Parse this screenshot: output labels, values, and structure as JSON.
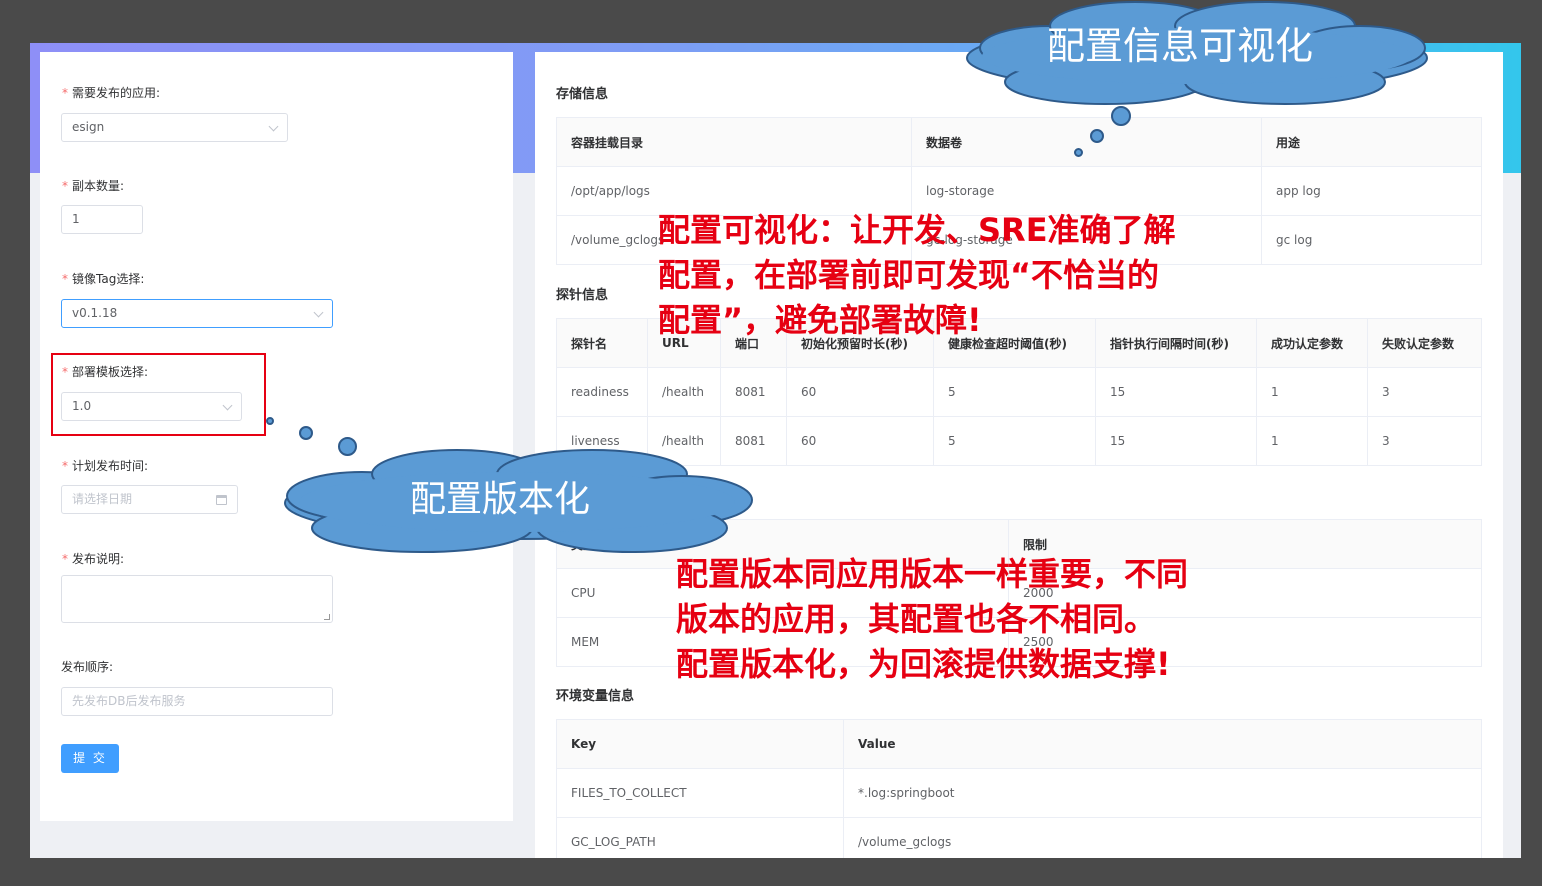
{
  "form": {
    "app": {
      "label": "需要发布的应用:",
      "value": "esign"
    },
    "replicas": {
      "label": "副本数量:",
      "value": "1"
    },
    "image_tag": {
      "label": "镜像Tag选择:",
      "value": "v0.1.18"
    },
    "template": {
      "label": "部署模板选择:",
      "value": "1.0"
    },
    "schedule": {
      "label": "计划发布时间:",
      "placeholder": "请选择日期"
    },
    "notes": {
      "label": "发布说明:"
    },
    "order": {
      "label": "发布顺序:",
      "placeholder": "先发布DB后发布服务"
    },
    "submit_label": "提 交"
  },
  "storage": {
    "title": "存储信息",
    "columns": [
      "容器挂载目录",
      "数据卷",
      "用途"
    ],
    "rows": [
      [
        "/opt/app/logs",
        "log-storage",
        "app log"
      ],
      [
        "/volume_gclogs",
        "gc-log-storage",
        "gc log"
      ]
    ]
  },
  "probe": {
    "title": "探针信息",
    "columns": [
      "探针名",
      "URL",
      "端口",
      "初始化预留时长(秒)",
      "健康检查超时阈值(秒)",
      "指针执行间隔时间(秒)",
      "成功认定参数",
      "失败认定参数"
    ],
    "rows": [
      [
        "readiness",
        "/health",
        "8081",
        "60",
        "5",
        "15",
        "1",
        "3"
      ],
      [
        "liveness",
        "/health",
        "8081",
        "60",
        "5",
        "15",
        "1",
        "3"
      ]
    ]
  },
  "resource": {
    "columns": [
      "类型",
      "限制"
    ],
    "rows": [
      [
        "CPU",
        "2000"
      ],
      [
        "MEM",
        "2500"
      ]
    ]
  },
  "env": {
    "title": "环境变量信息",
    "columns": [
      "Key",
      "Value"
    ],
    "rows": [
      [
        "FILES_TO_COLLECT",
        "*.log:springboot"
      ],
      [
        "GC_LOG_PATH",
        "/volume_gclogs"
      ]
    ]
  },
  "annotations": {
    "cloud_top": "配置信息可视化",
    "cloud_left": "配置版本化",
    "note_top": [
      "配置可视化：让开发、SRE准确了解",
      "配置，在部署前即可发现“不恰当的",
      "配置”，避免部署故障!"
    ],
    "note_bottom": [
      "配置版本同应用版本一样重要，不同",
      "版本的应用，其配置也各不相同。",
      "配置版本化，为回滚提供数据支撑!"
    ]
  }
}
